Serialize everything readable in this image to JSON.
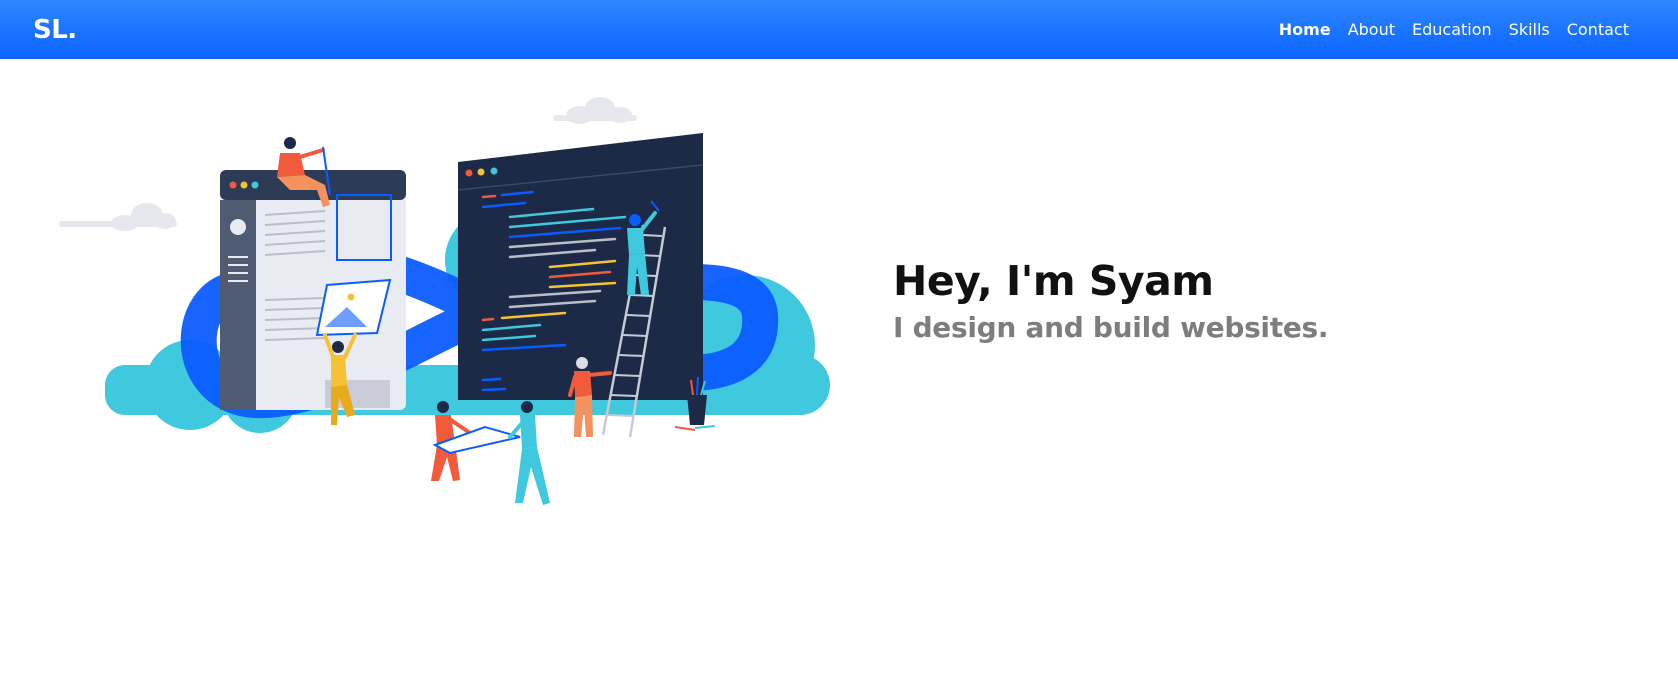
{
  "brand": {
    "text": "SL."
  },
  "nav": {
    "items": [
      {
        "label": "Home",
        "active": true
      },
      {
        "label": "About"
      },
      {
        "label": "Education"
      },
      {
        "label": "Skills"
      },
      {
        "label": "Contact"
      }
    ]
  },
  "hero": {
    "title": "Hey, I'm Syam",
    "subtitle": "I design and build websites."
  },
  "colors": {
    "nav_gradient_top": "#2f87ff",
    "nav_gradient_bottom": "#0d65ff",
    "accent_blue": "#0b5cff",
    "cloud_teal": "#3fc8de",
    "dark_panel": "#1c2a47",
    "title_text": "#111111",
    "subtitle_text": "#7d7d7d"
  }
}
